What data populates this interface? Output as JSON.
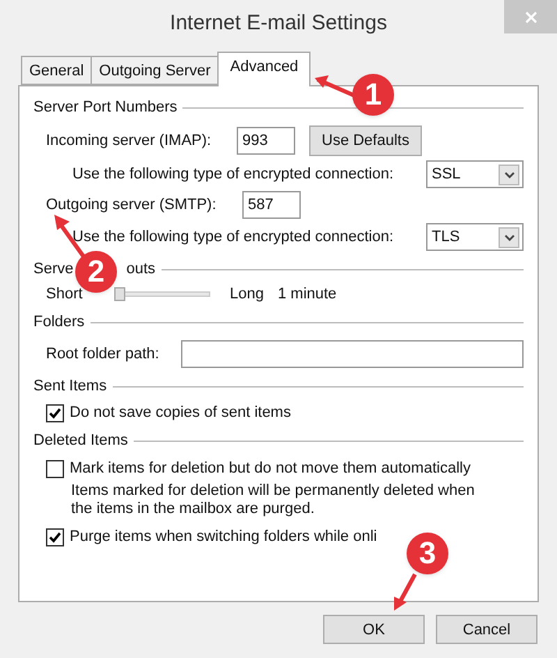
{
  "window": {
    "title": "Internet E-mail Settings"
  },
  "tabs": [
    {
      "label": "General",
      "selected": false
    },
    {
      "label": "Outgoing Server",
      "selected": false
    },
    {
      "label": "Advanced",
      "selected": true
    }
  ],
  "server_ports": {
    "header": "Server Port Numbers",
    "incoming_label": "Incoming server (IMAP):",
    "incoming_value": "993",
    "use_defaults": "Use Defaults",
    "incoming_encryption": {
      "label": "Use the following type of encrypted connection:",
      "value": "SSL"
    },
    "outgoing_label": "Outgoing server (SMTP):",
    "outgoing_value": "587",
    "outgoing_encryption": {
      "label": "Use the following type of encrypted connection:",
      "value": "TLS"
    }
  },
  "server_timeouts": {
    "header_parts": [
      "Serve",
      "outs"
    ],
    "min_label": "Short",
    "max_label": "Long",
    "level": 0.05,
    "reading": "1 minute"
  },
  "folders": {
    "header": "Folders",
    "root_label": "Root folder path:"
  },
  "sent_items": {
    "header": "Sent Items",
    "options": [
      {
        "label": "Do not save copies of sent items",
        "checked": true
      }
    ]
  },
  "deleted_items": {
    "header": "Deleted Items",
    "options": [
      {
        "label": "Mark items for deletion but do not move them automatically",
        "checked": false,
        "note": "Items marked for deletion will be permanently deleted when the items in the mailbox are purged."
      },
      {
        "label": "Purge items when switching folders while onli",
        "checked": true
      }
    ]
  },
  "buttons": [
    {
      "label": "OK"
    },
    {
      "label": "Cancel"
    }
  ],
  "callouts": [
    {
      "number": "1"
    },
    {
      "number": "2"
    },
    {
      "number": "3"
    }
  ]
}
